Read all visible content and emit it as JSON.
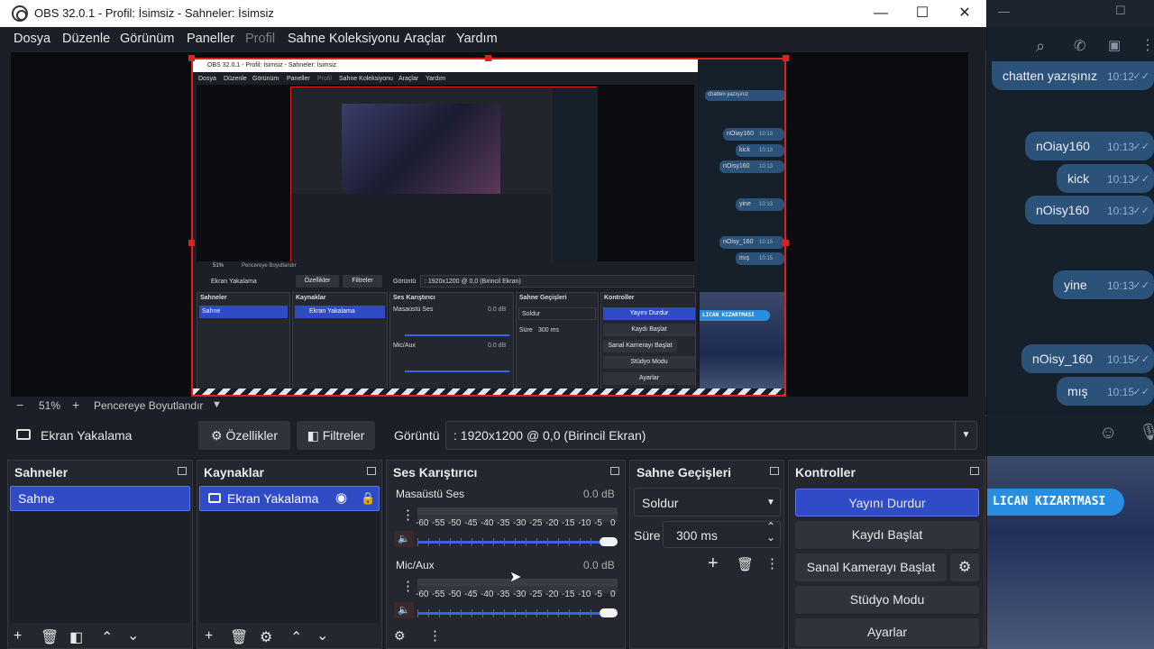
{
  "window": {
    "title": "OBS 32.0.1 - Profil: İsimsiz - Sahneler: İsimsiz",
    "min": "—",
    "max": "☐",
    "close": "✕"
  },
  "menu": [
    "Dosya",
    "Düzenle",
    "Görünüm",
    "Paneller",
    "Profil",
    "Sahne Koleksiyonu",
    "Araçlar",
    "Yardım"
  ],
  "preview": {
    "mini_title": "OBS 32.0.1 - Profil: İsimsiz - Sahneler: İsimsiz",
    "mini_menu": [
      "Dosya",
      "Düzenle",
      "Görünüm",
      "Paneller",
      "Profil",
      "Sahne Koleksiyonu",
      "Araçlar",
      "Yardım"
    ],
    "mini_zoom": "51%",
    "mini_fit": "Pencereye Boyutlandır",
    "mini_source": "Ekran Yakalama",
    "mini_props": "Özellikler",
    "mini_filters": "Filtreler",
    "mini_display_label": "Görüntü",
    "mini_display_value": ": 1920x1200 @ 0,0 (Birincil Ekran)",
    "mini_docks": [
      "Sahneler",
      "Kaynaklar",
      "Ses Karıştırıcı",
      "Sahne Geçişleri",
      "Kontroller"
    ],
    "mini_scene": "Sahne",
    "mini_source_item": "Ekran Yakalama",
    "mini_desktop": "Masaüstü Ses",
    "mini_mic": "Mic/Aux",
    "mini_db": "0.0 dB",
    "mini_transition": "Soldur",
    "mini_duration_label": "Süre",
    "mini_duration": "300 ms",
    "mini_controls": [
      "Yayını Durdur",
      "Kaydı Başlat",
      "Sanal Kamerayı Başlat",
      "Stüdyo Modu",
      "Ayarlar"
    ],
    "mini_chat": [
      {
        "text": "chatten yazışınız",
        "time": "10:12"
      },
      {
        "text": "nOiay160",
        "time": "10:13"
      },
      {
        "text": "kick",
        "time": "10:13"
      },
      {
        "text": "nOisy160",
        "time": "10:13"
      },
      {
        "text": "yine",
        "time": "10:13"
      },
      {
        "text": "nOisy_160",
        "time": "10:15"
      },
      {
        "text": "mış",
        "time": "10:15"
      }
    ],
    "mini_banner": "LICAN KIZARTMASI"
  },
  "zoom": {
    "minus": "−",
    "value": "51%",
    "plus": "+",
    "fit": "Pencereye Boyutlandır",
    "arrow": "▼"
  },
  "source_bar": {
    "source_name": "Ekran Yakalama",
    "properties": "Özellikler",
    "filters": "Filtreler",
    "display_label": "Görüntü",
    "display_value": ": 1920x1200 @ 0,0 (Birincil Ekran)"
  },
  "docks": {
    "scenes": {
      "title": "Sahneler",
      "items": [
        "Sahne"
      ]
    },
    "sources": {
      "title": "Kaynaklar",
      "items": [
        "Ekran Yakalama"
      ]
    },
    "mixer": {
      "title": "Ses Karıştırıcı",
      "channels": [
        {
          "name": "Masaüstü Ses",
          "db": "0.0 dB",
          "volume": 1.0
        },
        {
          "name": "Mic/Aux",
          "db": "0.0 dB",
          "volume": 1.0
        }
      ],
      "scale": [
        "-60",
        "-55",
        "-50",
        "-45",
        "-40",
        "-35",
        "-30",
        "-25",
        "-20",
        "-15",
        "-10",
        "-5",
        "0"
      ]
    },
    "transitions": {
      "title": "Sahne Geçişleri",
      "type": "Soldur",
      "duration_label": "Süre",
      "duration": "300 ms"
    },
    "controls": {
      "title": "Kontroller",
      "buttons": [
        "Yayını Durdur",
        "Kaydı Başlat",
        "Sanal Kamerayı Başlat",
        "Stüdyo Modu",
        "Ayarlar"
      ]
    }
  },
  "chat": {
    "messages": [
      {
        "text": "chatten yazışınız",
        "time": "10:12"
      },
      {
        "text": "nOiay160",
        "time": "10:13"
      },
      {
        "text": "kick",
        "time": "10:13"
      },
      {
        "text": "nOisy160",
        "time": "10:13"
      },
      {
        "text": "yine",
        "time": "10:13"
      },
      {
        "text": "nOisy_160",
        "time": "10:15"
      },
      {
        "text": "mış",
        "time": "10:15"
      }
    ],
    "banner": "LICAN KIZARTMASI"
  },
  "colors": {
    "accent": "#2f4bc6",
    "selection_border": "#e02020",
    "chat_bubble": "#2b5278"
  }
}
